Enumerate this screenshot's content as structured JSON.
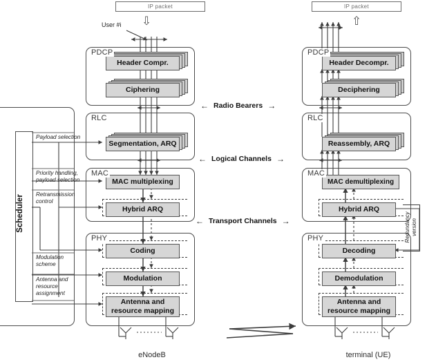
{
  "diagram": {
    "title_left": "eNodeB",
    "title_right": "terminal (UE)",
    "ip_packet_label": "IP packet",
    "user_label": "User #i"
  },
  "left_stack": {
    "layers": [
      {
        "name": "PDCP",
        "blocks": [
          {
            "label": "Header Compr.",
            "stacked": true
          },
          {
            "label": "Ciphering",
            "stacked": true
          }
        ]
      },
      {
        "name": "RLC",
        "blocks": [
          {
            "label": "Segmentation, ARQ",
            "stacked": true
          }
        ]
      },
      {
        "name": "MAC",
        "blocks": [
          {
            "label": "MAC multiplexing",
            "stacked": false
          },
          {
            "label": "Hybrid ARQ",
            "stacked": false
          }
        ]
      },
      {
        "name": "PHY",
        "blocks": [
          {
            "label": "Coding",
            "stacked": false
          },
          {
            "label": "Modulation",
            "stacked": false
          },
          {
            "label": "Antenna and",
            "label2": "resource mapping",
            "stacked": false
          }
        ]
      }
    ]
  },
  "right_stack": {
    "layers": [
      {
        "name": "PDCP",
        "blocks": [
          {
            "label": "Header Decompr.",
            "stacked": true
          },
          {
            "label": "Deciphering",
            "stacked": true
          }
        ]
      },
      {
        "name": "RLC",
        "blocks": [
          {
            "label": "Reassembly, ARQ",
            "stacked": true
          }
        ]
      },
      {
        "name": "MAC",
        "blocks": [
          {
            "label": "MAC demultiplexing",
            "stacked": false
          },
          {
            "label": "Hybrid ARQ",
            "stacked": false
          }
        ]
      },
      {
        "name": "PHY",
        "blocks": [
          {
            "label": "Decoding",
            "stacked": false
          },
          {
            "label": "Demodulation",
            "stacked": false
          },
          {
            "label": "Antenna and",
            "label2": "resource mapping",
            "stacked": false
          }
        ]
      }
    ]
  },
  "channels": [
    {
      "label": "Radio Bearers"
    },
    {
      "label": "Logical Channels"
    },
    {
      "label": "Transport Channels"
    }
  ],
  "scheduler": {
    "label": "Scheduler",
    "signals": [
      {
        "text": "Payload selection"
      },
      {
        "text": "Priority handling,\npayload selection"
      },
      {
        "text": "Retransmission\ncontrol"
      },
      {
        "text": "Modulation\nscheme"
      },
      {
        "text": "Antenna and\nresource\nassignment"
      }
    ]
  },
  "redundancy": {
    "label": "Redundancy\nversion"
  },
  "colors": {
    "process_fill": "#d6d6d6",
    "process_stroke": "#545454",
    "layer_stroke": "#4a4a4a",
    "line": "#3c3c3c",
    "text": "#111111"
  }
}
